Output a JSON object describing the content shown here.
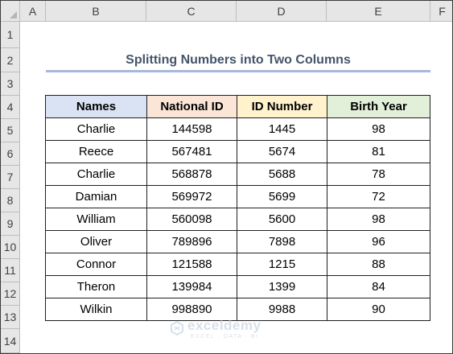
{
  "columns": [
    "A",
    "B",
    "C",
    "D",
    "E",
    "F"
  ],
  "rows": [
    "1",
    "2",
    "3",
    "4",
    "5",
    "6",
    "7",
    "8",
    "9",
    "10",
    "11",
    "12",
    "13",
    "14"
  ],
  "title": "Splitting Numbers into Two Columns",
  "table": {
    "headers": [
      "Names",
      "National ID",
      "ID Number",
      "Birth Year"
    ],
    "rows": [
      [
        "Charlie",
        "144598",
        "1445",
        "98"
      ],
      [
        "Reece",
        "567481",
        "5674",
        "81"
      ],
      [
        "Charlie",
        "568878",
        "5688",
        "78"
      ],
      [
        "Damian",
        "569972",
        "5699",
        "72"
      ],
      [
        "William",
        "560098",
        "5600",
        "98"
      ],
      [
        "Oliver",
        "789896",
        "7898",
        "96"
      ],
      [
        "Connor",
        "121588",
        "1215",
        "88"
      ],
      [
        "Theron",
        "139984",
        "1399",
        "84"
      ],
      [
        "Wilkin",
        "998890",
        "9988",
        "90"
      ]
    ]
  },
  "watermark": {
    "name": "exceldemy",
    "tagline": "EXCEL · DATA · BI"
  },
  "colors": {
    "names_header": "#dae3f3",
    "national_header": "#fbe5d6",
    "idnum_header": "#fff2cc",
    "birth_header": "#e2f0d9",
    "title_text": "#44546a",
    "title_underline": "#a5b9dc"
  }
}
